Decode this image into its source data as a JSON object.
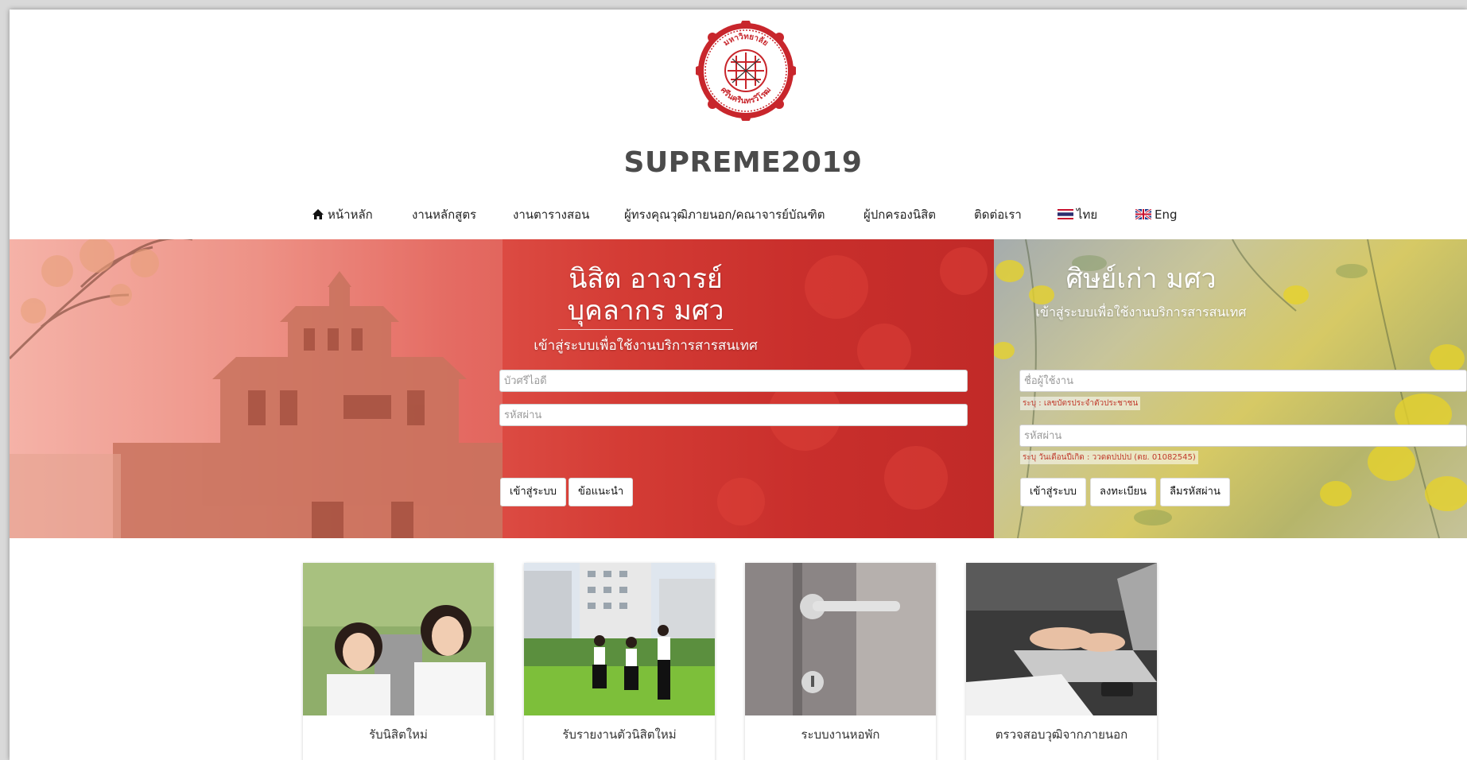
{
  "header": {
    "site_title": "SUPREME2019",
    "logo_text_top": "มหาวิทยาลัย",
    "logo_text_bottom": "ศรีนครินทรวิโรฒ"
  },
  "nav": {
    "items": [
      {
        "label": "หน้าหลัก",
        "icon": "home-icon"
      },
      {
        "label": "งานหลักสูตร"
      },
      {
        "label": "งานตารางสอน"
      },
      {
        "label": "ผู้ทรงคุณวุฒิภายนอก/คณาจารย์บัณฑิต"
      },
      {
        "label": "ผู้ปกครองนิสิต"
      },
      {
        "label": "ติดต่อเรา"
      },
      {
        "label": "ไทย",
        "icon": "thai-flag-icon"
      },
      {
        "label": "Eng",
        "icon": "uk-flag-icon"
      }
    ]
  },
  "login_staff": {
    "heading_line1": "นิสิต อาจารย์",
    "heading_line2": "บุคลากร มศว",
    "subheading": "เข้าสู่ระบบเพื่อใช้งานบริการสารสนเทศ",
    "username_placeholder": "บัวศรีไอดี",
    "password_placeholder": "รหัสผ่าน",
    "login_button": "เข้าสู่ระบบ",
    "help_button": "ข้อแนะนำ"
  },
  "login_alumni": {
    "heading": "ศิษย์เก่า มศว",
    "subheading": "เข้าสู่ระบบเพื่อใช้งานบริการสารสนเทศ",
    "username_placeholder": "ชื่อผู้ใช้งาน",
    "username_hint": "ระบุ : เลขบัตรประจำตัวประชาชน",
    "password_placeholder": "รหัสผ่าน",
    "password_hint": "ระบุ วันเดือนปีเกิด : ววดดปปปป (ตย. 01082545)",
    "login_button": "เข้าสู่ระบบ",
    "register_button": "ลงทะเบียน",
    "forgot_button": "ลืมรหัสผ่าน"
  },
  "cards": [
    {
      "label": "รับนิสิตใหม่"
    },
    {
      "label": "รับรายงานตัวนิสิตใหม่"
    },
    {
      "label": "ระบบงานหอพัก"
    },
    {
      "label": "ตรวจสอบวุฒิจากภายนอก"
    }
  ],
  "colors": {
    "brand_red": "#c62a2a",
    "title_gray": "#4b4b4b",
    "hint_red": "#c0392b"
  }
}
